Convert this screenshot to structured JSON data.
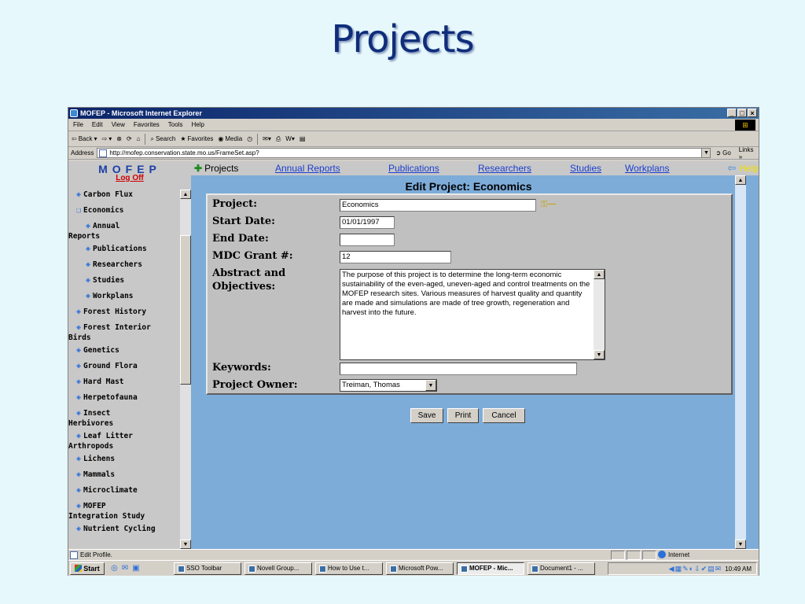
{
  "slide": {
    "title": "Projects"
  },
  "window": {
    "title": "MOFEP - Microsoft Internet Explorer",
    "controls": [
      "_",
      "□",
      "×"
    ]
  },
  "menu": [
    "File",
    "Edit",
    "View",
    "Favorites",
    "Tools",
    "Help"
  ],
  "toolbar": {
    "back": "Back",
    "search": "Search",
    "favorites": "Favorites",
    "media": "Media"
  },
  "address": {
    "label": "Address",
    "url": "http://mofep.conservation.state.mo.us/FrameSet.asp?",
    "go": "Go",
    "links": "Links"
  },
  "sidebar": {
    "logo": "MOFEP",
    "logoff": "Log Off",
    "items": [
      {
        "label": "Carbon Flux"
      },
      {
        "label": "Economics"
      },
      {
        "label": "Annual",
        "cont": "Reports"
      },
      {
        "label": "Publications"
      },
      {
        "label": "Researchers"
      },
      {
        "label": "Studies"
      },
      {
        "label": "Workplans"
      },
      {
        "label": "Forest History"
      },
      {
        "label": "Forest Interior",
        "cont": "Birds"
      },
      {
        "label": "Genetics"
      },
      {
        "label": "Ground Flora"
      },
      {
        "label": "Hard Mast"
      },
      {
        "label": "Herpetofauna"
      },
      {
        "label": "Insect",
        "cont": "Herbivores"
      },
      {
        "label": "Leaf Litter",
        "cont": "Arthropods"
      },
      {
        "label": "Lichens"
      },
      {
        "label": "Mammals"
      },
      {
        "label": "Microclimate"
      },
      {
        "label": "MOFEP",
        "cont": "Integration Study"
      },
      {
        "label": "Nutrient Cycling"
      }
    ]
  },
  "topnav": {
    "current": "Projects",
    "links": [
      "Annual Reports",
      "Publications",
      "Researchers",
      "Studies",
      "Workplans"
    ],
    "help": "Help"
  },
  "form": {
    "title": "Edit Project: Economics",
    "project_label": "Project:",
    "project_value": "Economics",
    "start_label": "Start Date:",
    "start_value": "01/01/1997",
    "end_label": "End Date:",
    "end_value": "",
    "grant_label": "MDC Grant #:",
    "grant_value": "12",
    "abstract_label_1": "Abstract and",
    "abstract_label_2": "Objectives:",
    "abstract_value": "The purpose of this project is to determine the long-term economic sustainability of the even-aged, uneven-aged and control treatments on the MOFEP research sites. Various measures of harvest quality and quantity are made and simulations are made of tree growth, regeneration and harvest into the future.",
    "keywords_label": "Keywords:",
    "keywords_value": "",
    "owner_label": "Project Owner:",
    "owner_value": "Treiman, Thomas",
    "buttons": {
      "save": "Save",
      "print": "Print",
      "cancel": "Cancel"
    }
  },
  "status": {
    "text": "Edit Profile.",
    "zone": "Internet"
  },
  "taskbar": {
    "start": "Start",
    "tasks": [
      "SSO Toolbar",
      "Novell Group...",
      "How to Use t...",
      "Microsoft Pow...",
      "MOFEP - Mic...",
      "Document1 - ..."
    ],
    "clock": "10:49 AM"
  },
  "colors": {
    "content_bg": "#7dacd9",
    "link": "#1a3fd0",
    "logoff": "#d00000",
    "help": "#f0e000"
  }
}
